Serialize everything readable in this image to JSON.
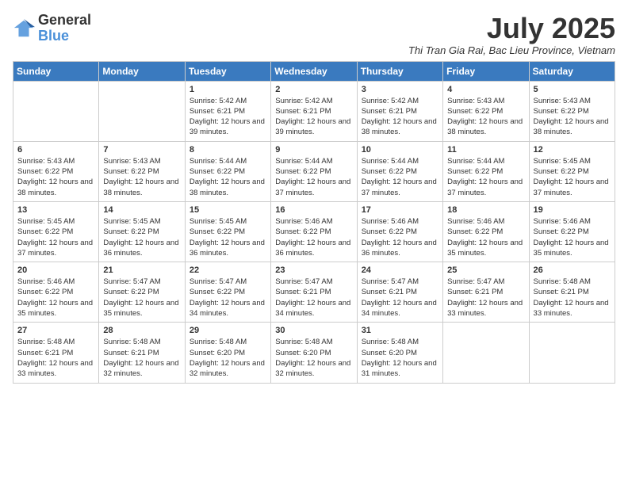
{
  "logo": {
    "line1": "General",
    "line2": "Blue"
  },
  "title": "July 2025",
  "subtitle": "Thi Tran Gia Rai, Bac Lieu Province, Vietnam",
  "weekdays": [
    "Sunday",
    "Monday",
    "Tuesday",
    "Wednesday",
    "Thursday",
    "Friday",
    "Saturday"
  ],
  "weeks": [
    [
      {
        "day": "",
        "info": ""
      },
      {
        "day": "",
        "info": ""
      },
      {
        "day": "1",
        "info": "Sunrise: 5:42 AM\nSunset: 6:21 PM\nDaylight: 12 hours and 39 minutes."
      },
      {
        "day": "2",
        "info": "Sunrise: 5:42 AM\nSunset: 6:21 PM\nDaylight: 12 hours and 39 minutes."
      },
      {
        "day": "3",
        "info": "Sunrise: 5:42 AM\nSunset: 6:21 PM\nDaylight: 12 hours and 38 minutes."
      },
      {
        "day": "4",
        "info": "Sunrise: 5:43 AM\nSunset: 6:22 PM\nDaylight: 12 hours and 38 minutes."
      },
      {
        "day": "5",
        "info": "Sunrise: 5:43 AM\nSunset: 6:22 PM\nDaylight: 12 hours and 38 minutes."
      }
    ],
    [
      {
        "day": "6",
        "info": "Sunrise: 5:43 AM\nSunset: 6:22 PM\nDaylight: 12 hours and 38 minutes."
      },
      {
        "day": "7",
        "info": "Sunrise: 5:43 AM\nSunset: 6:22 PM\nDaylight: 12 hours and 38 minutes."
      },
      {
        "day": "8",
        "info": "Sunrise: 5:44 AM\nSunset: 6:22 PM\nDaylight: 12 hours and 38 minutes."
      },
      {
        "day": "9",
        "info": "Sunrise: 5:44 AM\nSunset: 6:22 PM\nDaylight: 12 hours and 37 minutes."
      },
      {
        "day": "10",
        "info": "Sunrise: 5:44 AM\nSunset: 6:22 PM\nDaylight: 12 hours and 37 minutes."
      },
      {
        "day": "11",
        "info": "Sunrise: 5:44 AM\nSunset: 6:22 PM\nDaylight: 12 hours and 37 minutes."
      },
      {
        "day": "12",
        "info": "Sunrise: 5:45 AM\nSunset: 6:22 PM\nDaylight: 12 hours and 37 minutes."
      }
    ],
    [
      {
        "day": "13",
        "info": "Sunrise: 5:45 AM\nSunset: 6:22 PM\nDaylight: 12 hours and 37 minutes."
      },
      {
        "day": "14",
        "info": "Sunrise: 5:45 AM\nSunset: 6:22 PM\nDaylight: 12 hours and 36 minutes."
      },
      {
        "day": "15",
        "info": "Sunrise: 5:45 AM\nSunset: 6:22 PM\nDaylight: 12 hours and 36 minutes."
      },
      {
        "day": "16",
        "info": "Sunrise: 5:46 AM\nSunset: 6:22 PM\nDaylight: 12 hours and 36 minutes."
      },
      {
        "day": "17",
        "info": "Sunrise: 5:46 AM\nSunset: 6:22 PM\nDaylight: 12 hours and 36 minutes."
      },
      {
        "day": "18",
        "info": "Sunrise: 5:46 AM\nSunset: 6:22 PM\nDaylight: 12 hours and 35 minutes."
      },
      {
        "day": "19",
        "info": "Sunrise: 5:46 AM\nSunset: 6:22 PM\nDaylight: 12 hours and 35 minutes."
      }
    ],
    [
      {
        "day": "20",
        "info": "Sunrise: 5:46 AM\nSunset: 6:22 PM\nDaylight: 12 hours and 35 minutes."
      },
      {
        "day": "21",
        "info": "Sunrise: 5:47 AM\nSunset: 6:22 PM\nDaylight: 12 hours and 35 minutes."
      },
      {
        "day": "22",
        "info": "Sunrise: 5:47 AM\nSunset: 6:22 PM\nDaylight: 12 hours and 34 minutes."
      },
      {
        "day": "23",
        "info": "Sunrise: 5:47 AM\nSunset: 6:21 PM\nDaylight: 12 hours and 34 minutes."
      },
      {
        "day": "24",
        "info": "Sunrise: 5:47 AM\nSunset: 6:21 PM\nDaylight: 12 hours and 34 minutes."
      },
      {
        "day": "25",
        "info": "Sunrise: 5:47 AM\nSunset: 6:21 PM\nDaylight: 12 hours and 33 minutes."
      },
      {
        "day": "26",
        "info": "Sunrise: 5:48 AM\nSunset: 6:21 PM\nDaylight: 12 hours and 33 minutes."
      }
    ],
    [
      {
        "day": "27",
        "info": "Sunrise: 5:48 AM\nSunset: 6:21 PM\nDaylight: 12 hours and 33 minutes."
      },
      {
        "day": "28",
        "info": "Sunrise: 5:48 AM\nSunset: 6:21 PM\nDaylight: 12 hours and 32 minutes."
      },
      {
        "day": "29",
        "info": "Sunrise: 5:48 AM\nSunset: 6:20 PM\nDaylight: 12 hours and 32 minutes."
      },
      {
        "day": "30",
        "info": "Sunrise: 5:48 AM\nSunset: 6:20 PM\nDaylight: 12 hours and 32 minutes."
      },
      {
        "day": "31",
        "info": "Sunrise: 5:48 AM\nSunset: 6:20 PM\nDaylight: 12 hours and 31 minutes."
      },
      {
        "day": "",
        "info": ""
      },
      {
        "day": "",
        "info": ""
      }
    ]
  ]
}
